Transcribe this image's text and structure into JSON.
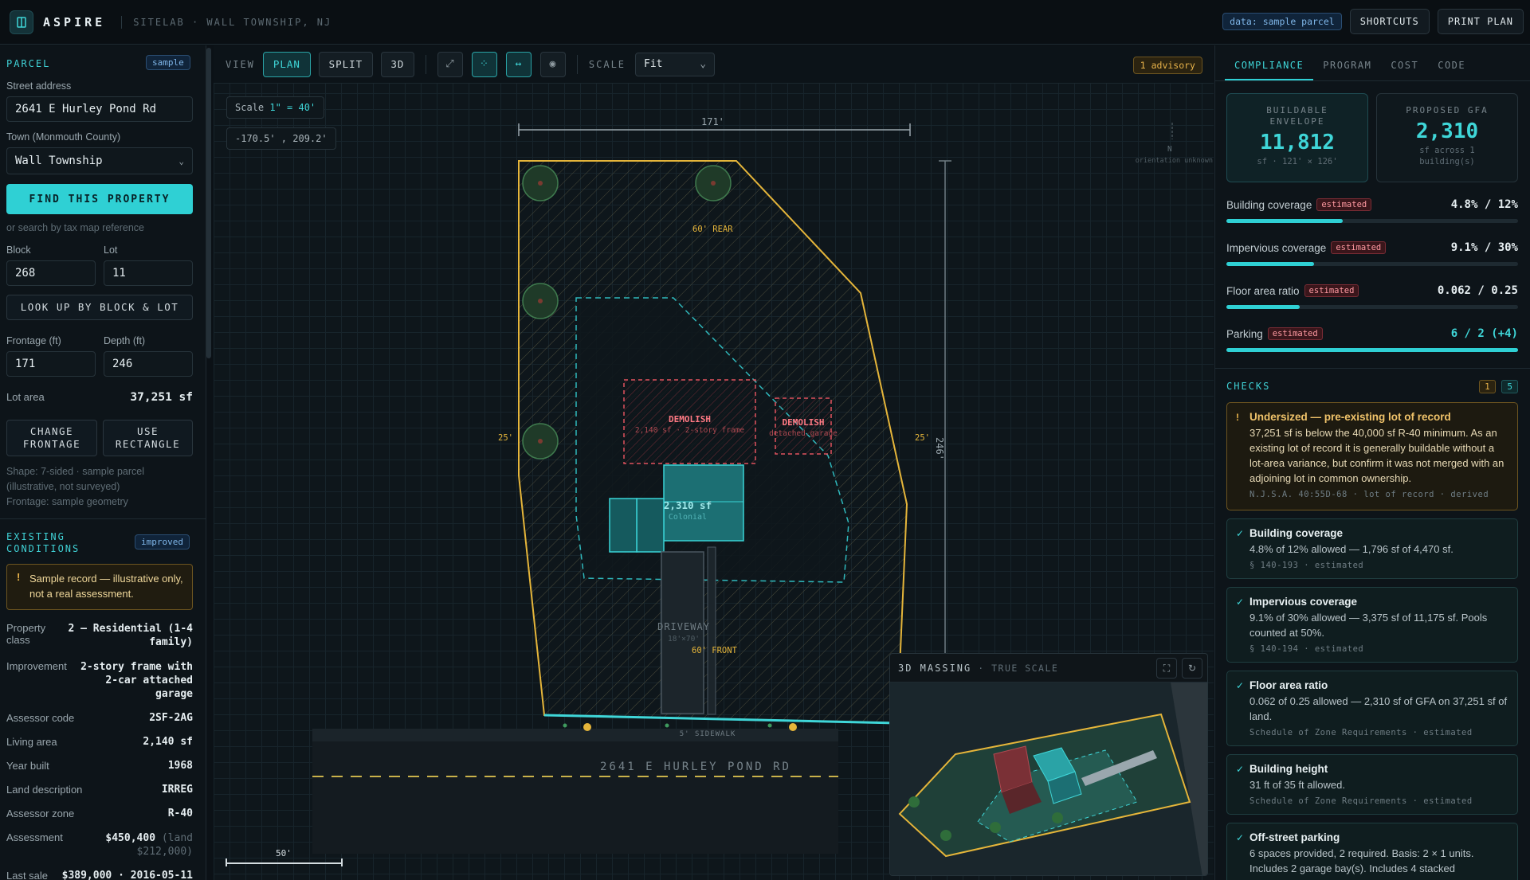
{
  "app": {
    "brand": "ASPIRE",
    "subtitle": "SITELAB · WALL TOWNSHIP, NJ"
  },
  "topbar": {
    "data_tag": "data: sample parcel",
    "shortcuts": "SHORTCUTS",
    "print": "PRINT PLAN"
  },
  "parcel": {
    "heading": "PARCEL",
    "badge": "sample",
    "street_label": "Street address",
    "street_value": "2641 E Hurley Pond Rd",
    "town_label": "Town (Monmouth County)",
    "town_value": "Wall Township",
    "find_btn": "FIND THIS PROPERTY",
    "tax_hint": "or search by tax map reference",
    "block_label": "Block",
    "block_value": "268",
    "lot_label": "Lot",
    "lot_value": "11",
    "lookup_btn": "LOOK UP BY BLOCK & LOT",
    "frontage_label": "Frontage (ft)",
    "frontage_value": "171",
    "depth_label": "Depth (ft)",
    "depth_value": "246",
    "lot_area_label": "Lot area",
    "lot_area_value": "37,251 sf",
    "change_frontage_btn": "CHANGE FRONTAGE",
    "use_rect_btn": "USE RECTANGLE",
    "shape_note": "Shape: 7-sided · sample parcel",
    "shape_note2": "(illustrative, not surveyed)",
    "frontage_note": "Frontage: sample geometry"
  },
  "existing": {
    "heading": "EXISTING CONDITIONS",
    "badge": "improved",
    "warning": "Sample record — illustrative only, not a real assessment.",
    "rows": [
      {
        "k": "Property class",
        "v": "2 — Residential (1-4 family)"
      },
      {
        "k": "Improvement",
        "v": "2-story frame with 2-car attached garage"
      },
      {
        "k": "Assessor code",
        "v": "2SF-2AG"
      },
      {
        "k": "Living area",
        "v": "2,140 sf"
      },
      {
        "k": "Year built",
        "v": "1968"
      },
      {
        "k": "Land description",
        "v": "IRREG"
      },
      {
        "k": "Assessor zone",
        "v": "R-40"
      },
      {
        "k": "Assessment",
        "v": "$450,400",
        "extra": "(land $212,000)"
      },
      {
        "k": "Last sale",
        "v": "$389,000 · 2016-05-11"
      }
    ]
  },
  "toolbar": {
    "view_label": "VIEW",
    "plan": "PLAN",
    "split": "SPLIT",
    "three_d": "3D",
    "scale_label": "SCALE",
    "scale_value": "Fit",
    "advisory": "1 advisory"
  },
  "canvas": {
    "scale_chip_prefix": "Scale ",
    "scale_chip_value": "1\" = 40'",
    "coords": "-170.5' , 209.2'",
    "dim_top": "171'",
    "dim_right": "246'",
    "rear_setback": "60' REAR",
    "front_setback": "60' FRONT",
    "side_left": "25'",
    "side_right": "25'",
    "demolish_1": "DEMOLISH",
    "demolish_1_sub": "2,140 sf · 2-story frame",
    "demolish_2": "DEMOLISH",
    "demolish_2_sub": "detached garage",
    "building_area": "2,310 sf",
    "building_style": "Colonial",
    "driveway": "DRIVEWAY",
    "driveway_sub": "18'×70'",
    "sidewalk": "5' SIDEWALK",
    "road": "2641 E HURLEY POND RD",
    "north": "N",
    "north_note": "orientation unknown",
    "scale_bar": "50'"
  },
  "massing": {
    "title": "3D MASSING",
    "subtitle": "· TRUE SCALE"
  },
  "right": {
    "tabs": [
      "COMPLIANCE",
      "PROGRAM",
      "COST",
      "CODE"
    ],
    "envelope": {
      "label": "BUILDABLE ENVELOPE",
      "value": "11,812",
      "sub": "sf · 121' × 126'"
    },
    "gfa": {
      "label": "PROPOSED GFA",
      "value": "2,310",
      "sub": "sf across 1 building(s)"
    },
    "metrics": [
      {
        "name": "Building coverage",
        "tag": "estimated",
        "value": "4.8% / 12%",
        "fill": 0.4
      },
      {
        "name": "Impervious coverage",
        "tag": "estimated",
        "value": "9.1% / 30%",
        "fill": 0.3
      },
      {
        "name": "Floor area ratio",
        "tag": "estimated",
        "value": "0.062 / 0.25",
        "fill": 0.25
      },
      {
        "name": "Parking",
        "tag": "estimated",
        "value": "6 / 2 (+4)",
        "fill": 1.0
      }
    ],
    "checks_label": "CHECKS",
    "warn_count": "1",
    "ok_count": "5",
    "checks": [
      {
        "type": "warn",
        "mark": "!",
        "title": "Undersized — pre-existing lot of record",
        "body": "37,251 sf is below the 40,000 sf R-40 minimum. As an existing lot of record it is generally buildable without a lot-area variance, but confirm it was not merged with an adjoining lot in common ownership.",
        "ref": "N.J.S.A. 40:55D-68 · lot of record · derived"
      },
      {
        "type": "ok",
        "mark": "✓",
        "title": "Building coverage",
        "body": "4.8% of 12% allowed — 1,796 sf of 4,470 sf.",
        "ref": "§ 140-193 · estimated"
      },
      {
        "type": "ok",
        "mark": "✓",
        "title": "Impervious coverage",
        "body": "9.1% of 30% allowed — 3,375 sf of 11,175 sf. Pools counted at 50%.",
        "ref": "§ 140-194 · estimated"
      },
      {
        "type": "ok",
        "mark": "✓",
        "title": "Floor area ratio",
        "body": "0.062 of 0.25 allowed — 2,310 sf of GFA on 37,251 sf of land.",
        "ref": "Schedule of Zone Requirements · estimated"
      },
      {
        "type": "ok",
        "mark": "✓",
        "title": "Building height",
        "body": "31 ft of 35 ft allowed.",
        "ref": "Schedule of Zone Requirements · estimated"
      },
      {
        "type": "ok",
        "mark": "✓",
        "title": "Off-street parking",
        "body": "6 spaces provided, 2 required. Basis: 2 × 1 units. Includes 2 garage bay(s). Includes 4 stacked",
        "ref": ""
      }
    ]
  },
  "colors": {
    "accent": "#2fd0d4",
    "lot_line": "#e5b53a",
    "demolish": "#e0525e",
    "warning": "#e8b34a"
  }
}
